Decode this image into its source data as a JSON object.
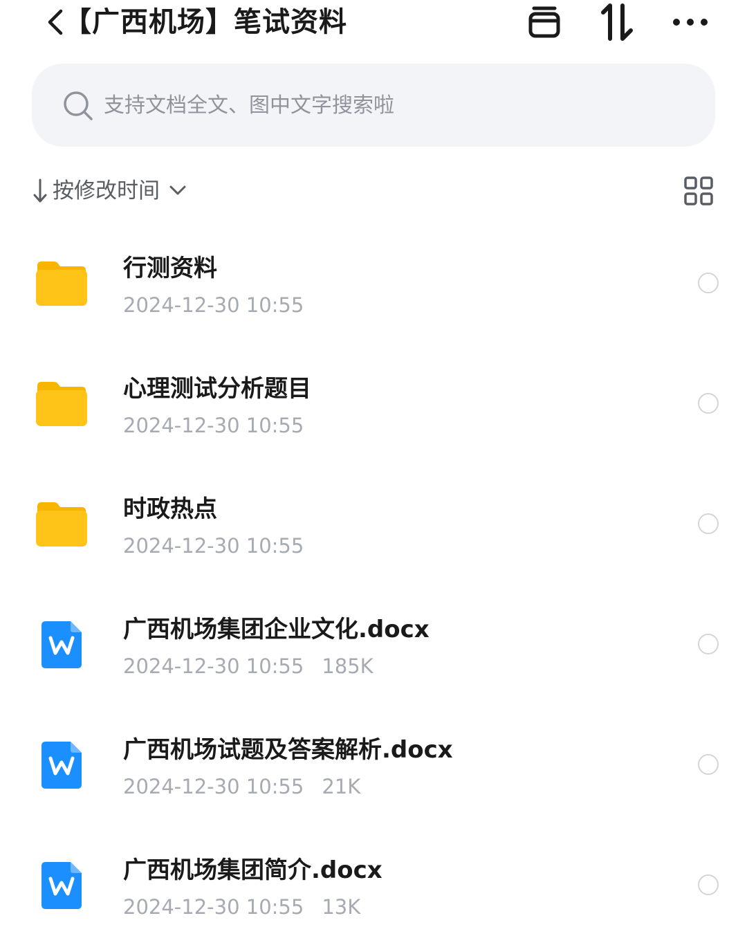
{
  "header": {
    "title": "【广西机场】笔试资料"
  },
  "search": {
    "placeholder": "支持文档全文、图中文字搜索啦"
  },
  "sort": {
    "label": "按修改时间"
  },
  "items": [
    {
      "type": "folder",
      "name": "行测资料",
      "modified": "2024-12-30 10:55",
      "size": ""
    },
    {
      "type": "folder",
      "name": "心理测试分析题目",
      "modified": "2024-12-30 10:55",
      "size": ""
    },
    {
      "type": "folder",
      "name": "时政热点",
      "modified": "2024-12-30 10:55",
      "size": ""
    },
    {
      "type": "docx",
      "name": "广西机场集团企业文化.docx",
      "modified": "2024-12-30 10:55",
      "size": "185K"
    },
    {
      "type": "docx",
      "name": "广西机场试题及答案解析.docx",
      "modified": "2024-12-30 10:55",
      "size": "21K"
    },
    {
      "type": "docx",
      "name": "广西机场集团简介.docx",
      "modified": "2024-12-30 10:55",
      "size": "13K"
    }
  ],
  "icons": {
    "back": "chevron-left-icon",
    "inbox": "inbox-icon",
    "sort": "sort-arrows-icon",
    "more": "more-dots-icon",
    "search": "search-icon",
    "sort_direction": "arrow-down-icon",
    "sort_dropdown": "chevron-down-icon",
    "grid": "grid-view-icon",
    "folder": "folder-icon",
    "word": "word-doc-icon"
  },
  "colors": {
    "folder": "#FFC417",
    "word": "#1C8FFF",
    "meta_text": "#A6AAB2",
    "search_bg": "#F3F4F7"
  }
}
